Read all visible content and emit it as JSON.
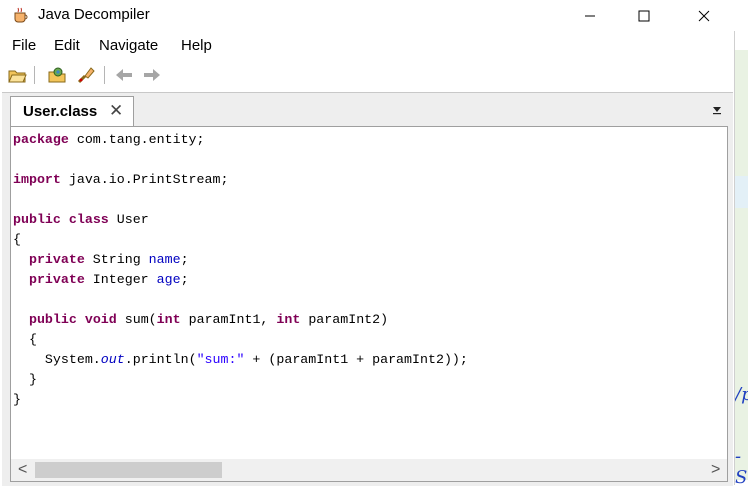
{
  "window": {
    "title": "Java Decompiler"
  },
  "window_controls": {
    "minimize": "—",
    "maximize": "☐",
    "close": "✕"
  },
  "menu": [
    "File",
    "Edit",
    "Navigate",
    "Help"
  ],
  "toolbar": {
    "icons": [
      "open-folder-icon",
      "open-type-icon",
      "search-icon",
      "back-arrow-icon",
      "forward-arrow-icon"
    ]
  },
  "tabs": [
    {
      "label": "User.class",
      "close": "✕"
    }
  ],
  "editor": {
    "language": "java",
    "lines": [
      "package com.tang.entity;",
      "",
      "import java.io.PrintStream;",
      "",
      "public class User",
      "{",
      "  private String name;",
      "  private Integer age;",
      "",
      "  public void sum(int paramInt1, int paramInt2)",
      "  {",
      "    System.out.println(\"sum:\" + (paramInt1 + paramInt2));",
      "  }",
      "}"
    ]
  },
  "scrollbar": {
    "left_arrow": "<",
    "right_arrow": ">",
    "position_fraction": 0.0,
    "visible_fraction": 0.28
  },
  "background_window": {
    "fragments": [
      "/p",
      "-S"
    ]
  },
  "colors": {
    "keyword": "#7f0055",
    "field": "#0000c0",
    "string": "#2a00ff",
    "tab_area": "#eeeeee"
  }
}
